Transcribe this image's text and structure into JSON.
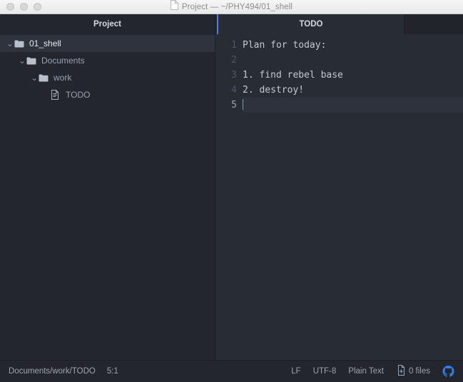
{
  "window": {
    "title": "Project — ~/PHY494/01_shell",
    "title_icon": "document-icon",
    "traffic_lights": [
      "close-button",
      "minimize-button",
      "zoom-button"
    ]
  },
  "sidebar": {
    "header": "Project",
    "items": [
      {
        "label": "01_shell",
        "icon": "folder-icon",
        "twisty": "⌄",
        "depth": 0,
        "selected": true,
        "expanded": true
      },
      {
        "label": "Documents",
        "icon": "folder-icon",
        "twisty": "⌄",
        "depth": 1,
        "selected": false,
        "expanded": true
      },
      {
        "label": "work",
        "icon": "folder-icon",
        "twisty": "⌄",
        "depth": 2,
        "selected": false,
        "expanded": true
      },
      {
        "label": "TODO",
        "icon": "file-text-icon",
        "twisty": "",
        "depth": 3,
        "selected": false,
        "expanded": false
      }
    ]
  },
  "tabs": [
    {
      "label": "TODO",
      "active": true
    }
  ],
  "editor": {
    "line_numbers": [
      "1",
      "2",
      "3",
      "4",
      "5"
    ],
    "lines": [
      "Plan for today:",
      "",
      "1. find rebel base",
      "2. destroy!",
      ""
    ],
    "cursor_line_index": 4
  },
  "statusbar": {
    "file_path": "Documents/work/TODO",
    "cursor_position": "5:1",
    "line_ending": "LF",
    "encoding": "UTF-8",
    "grammar": "Plain Text",
    "git_changes": "0 files",
    "git_changes_icon": "diff-files-icon",
    "github_icon": "github-octoface-icon"
  },
  "colors": {
    "accent_blue": "#5a78d6",
    "github_blue": "#2f80ed",
    "editor_bg": "#282c34",
    "sidebar_bg": "#23262e",
    "tabbar_bg": "#21242b"
  }
}
